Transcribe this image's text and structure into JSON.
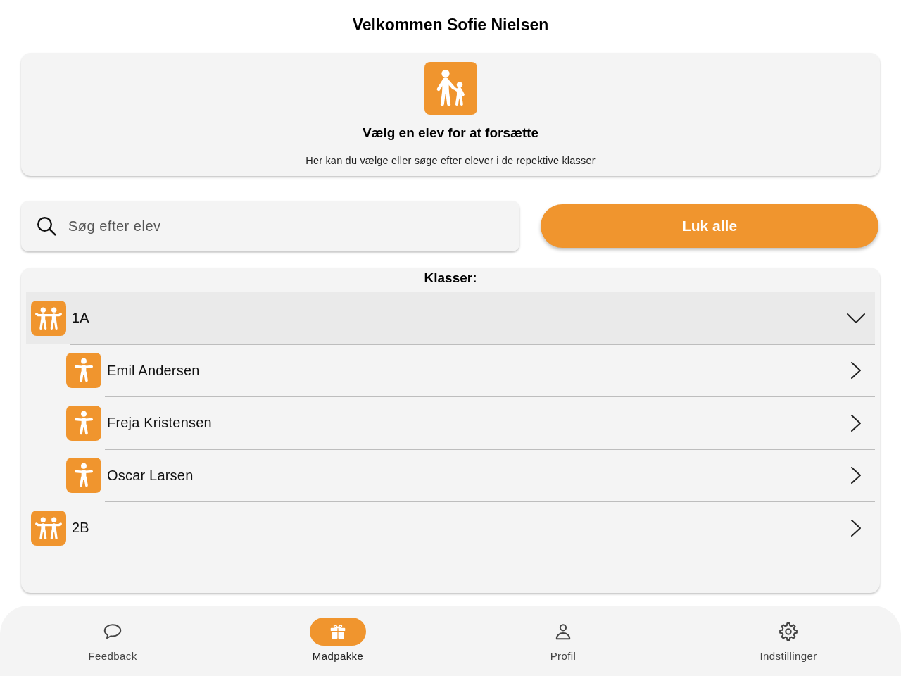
{
  "header": {
    "title": "Velkommen Sofie Nielsen"
  },
  "intro_card": {
    "heading": "Vælg en elev for at forsætte",
    "description": "Her kan du vælge eller søge efter elever i de repektive klasser"
  },
  "search": {
    "placeholder": "Søg efter elev"
  },
  "close_all_button": {
    "label": "Luk alle"
  },
  "classes": {
    "heading": "Klasser:",
    "items": [
      {
        "name": "1A",
        "expanded": true,
        "children": [
          {
            "name": "Emil Andersen"
          },
          {
            "name": "Freja Kristensen"
          },
          {
            "name": "Oscar Larsen"
          }
        ]
      },
      {
        "name": "2B",
        "expanded": false
      }
    ]
  },
  "bottom_nav": [
    {
      "label": "Feedback",
      "selected": false
    },
    {
      "label": "Madpakke",
      "selected": true
    },
    {
      "label": "Profil",
      "selected": false
    },
    {
      "label": "Indstillinger",
      "selected": false
    }
  ]
}
